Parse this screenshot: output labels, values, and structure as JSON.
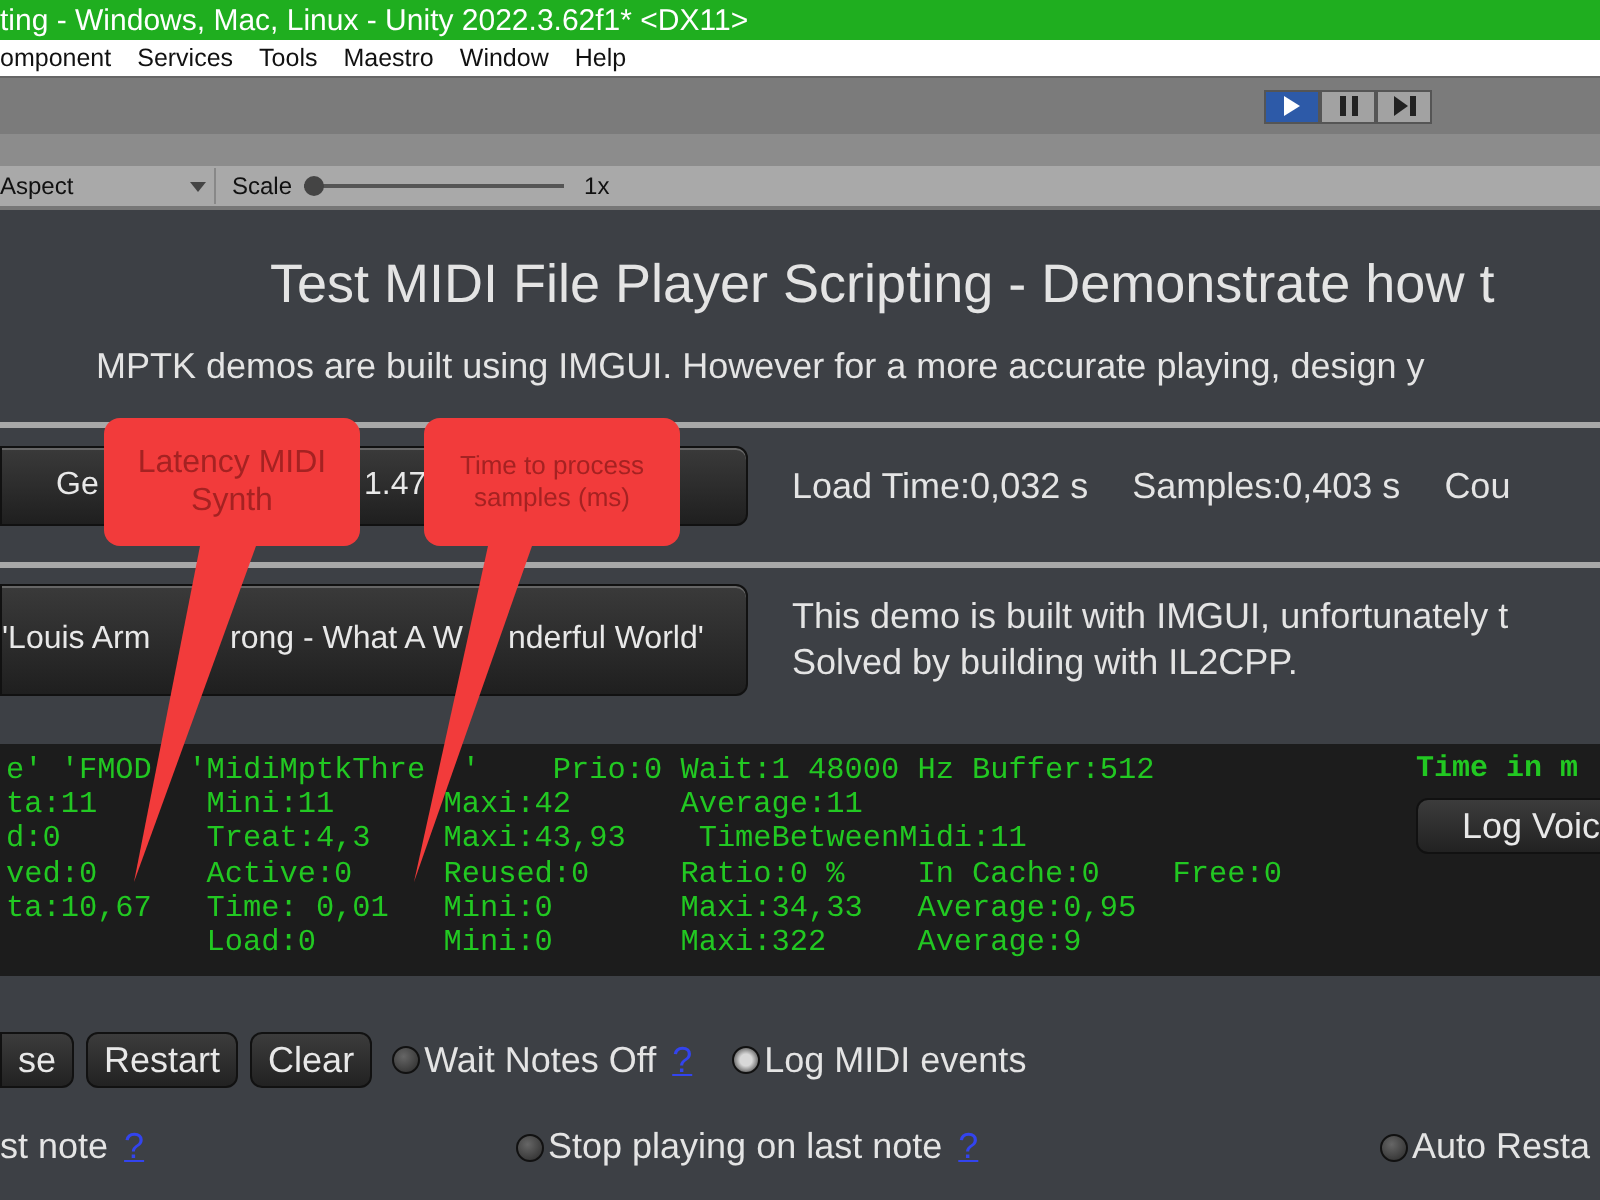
{
  "window": {
    "title": "ting - Windows, Mac, Linux - Unity 2022.3.62f1* <DX11>"
  },
  "menu": [
    "omponent",
    "Services",
    "Tools",
    "Maestro",
    "Window",
    "Help"
  ],
  "play_controls": [
    {
      "kind": "play",
      "selected": true
    },
    {
      "kind": "pause",
      "selected": false
    },
    {
      "kind": "step",
      "selected": false
    }
  ],
  "game_bar": {
    "aspect": "Aspect",
    "scale_label": "Scale",
    "scale": {
      "level": 0
    },
    "scale_value": "1x"
  },
  "heading": "Test MIDI File Player Scripting - Demonstrate how t",
  "subheading": "MPTK demos are built using IMGUI. However for a more accurate playing, design y",
  "sections": [
    {
      "button_parts": [
        "Ge",
        "1.47"
      ],
      "info": [
        "Load Time:0,032 s",
        "Samples:0,403 s",
        "Cou"
      ]
    },
    {
      "button_parts": [
        "'Louis Arm",
        "rong - What A W",
        "nderful World'"
      ],
      "info": [
        "This demo is built with IMGUI, unfortunately t",
        "Solved by building with IL2CPP."
      ]
    }
  ],
  "log": {
    "lines": [
      "e' 'FMOD  'MidiMptkThre  '    Prio:0 Wait:1 48000 Hz Buffer:512",
      "ta:11      Mini:11      Maxi:42      Average:11",
      "d:0        Treat:4,3    Maxi:43,93    TimeBetweenMidi:11",
      "ved:0      Active:0     Reused:0     Ratio:0 %    In Cache:0    Free:0",
      "ta:10,67   Time: 0,01   Mini:0       Maxi:34,33   Average:0,95",
      "           Load:0       Mini:0       Maxi:322     Average:9"
    ],
    "header": "Time in m",
    "button": "Log Voic"
  },
  "controls_row": {
    "buttons": [
      "se",
      "Restart",
      "Clear"
    ],
    "options": [
      {
        "label": "Wait Notes Off",
        "help": "?",
        "checked": false
      },
      {
        "label": "Log MIDI events",
        "checked": true
      }
    ]
  },
  "options_row": [
    {
      "kind": "text",
      "label": "st note",
      "help": "?"
    },
    {
      "kind": "checkbox",
      "label": "Stop playing on last note",
      "help": "?",
      "checked": false
    },
    {
      "kind": "checkbox",
      "label": "Auto Resta",
      "checked": false
    }
  ],
  "callouts": [
    {
      "text": "Latency MIDI Synth"
    },
    {
      "text": "Time to process samples (ms)"
    }
  ]
}
